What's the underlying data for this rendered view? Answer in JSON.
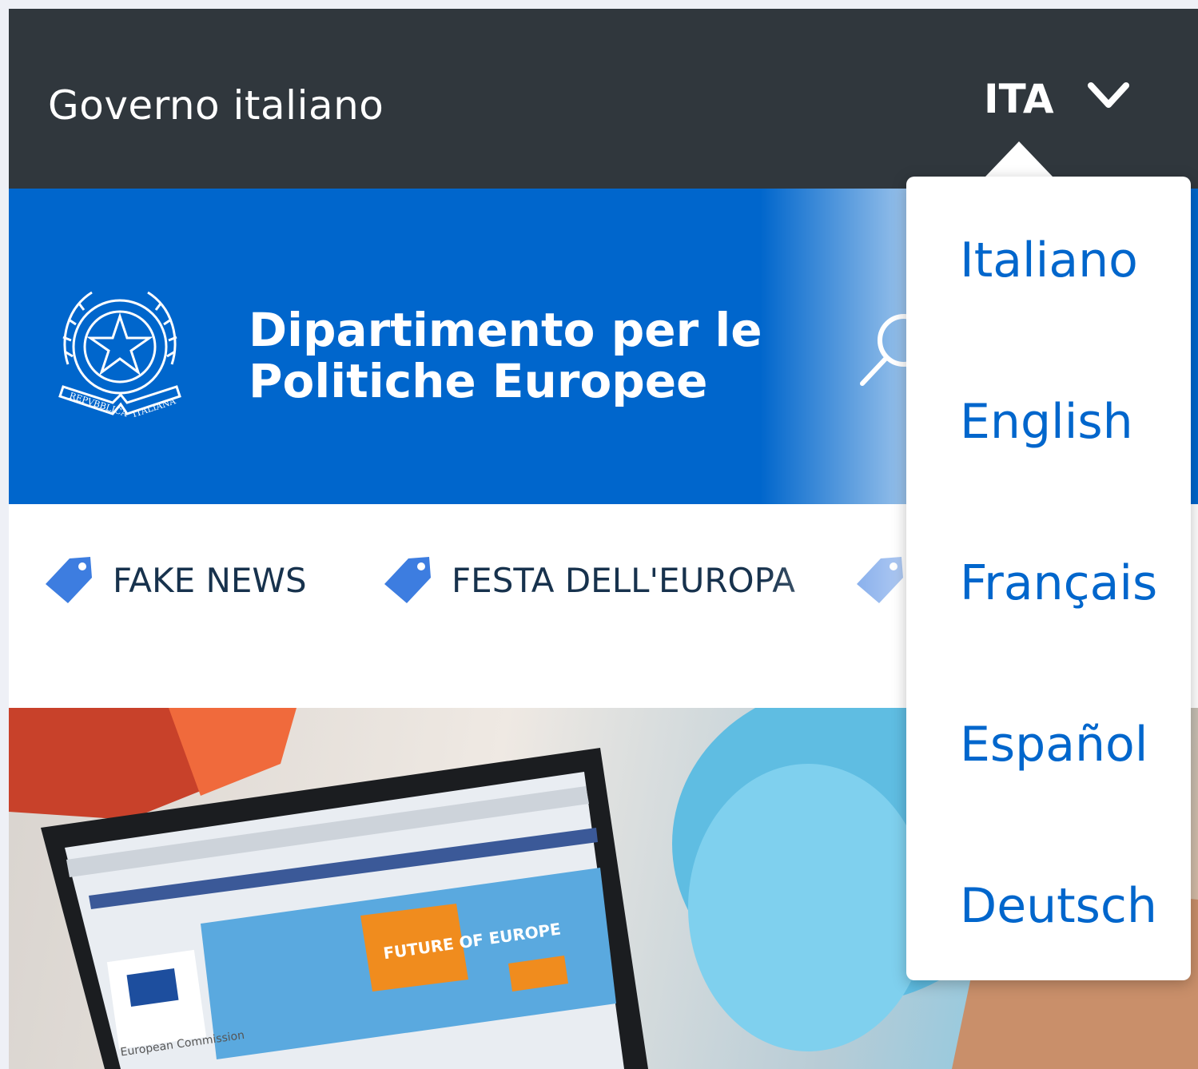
{
  "topbar": {
    "title": "Governo italiano",
    "language_current": "ITA",
    "chevron_icon": "chevron-down-icon"
  },
  "header": {
    "department_line1": "Dipartimento per le",
    "department_line2": "Politiche Europee",
    "emblem_icon": "italian-republic-emblem-icon",
    "emblem_text": "REPVBBLICA ITALIANA",
    "search_icon": "search-icon"
  },
  "tags": [
    {
      "label": "FAKE NEWS",
      "icon": "tag-icon"
    },
    {
      "label": "FESTA DELL'EUROPA",
      "icon": "tag-icon"
    },
    {
      "label": "",
      "icon": "tag-icon"
    }
  ],
  "language_menu": {
    "items": [
      "Italiano",
      "English",
      "Français",
      "Español",
      "Deutsch"
    ]
  },
  "hero": {
    "laptop_screen_text": "FUTURE OF EUROPE",
    "laptop_caption": "European Commission"
  },
  "colors": {
    "topbar_bg": "#30373d",
    "header_bg": "#0066cc",
    "link_blue": "#0066cc",
    "tag_icon_blue": "#3d7de0",
    "tag_text": "#17324d"
  }
}
